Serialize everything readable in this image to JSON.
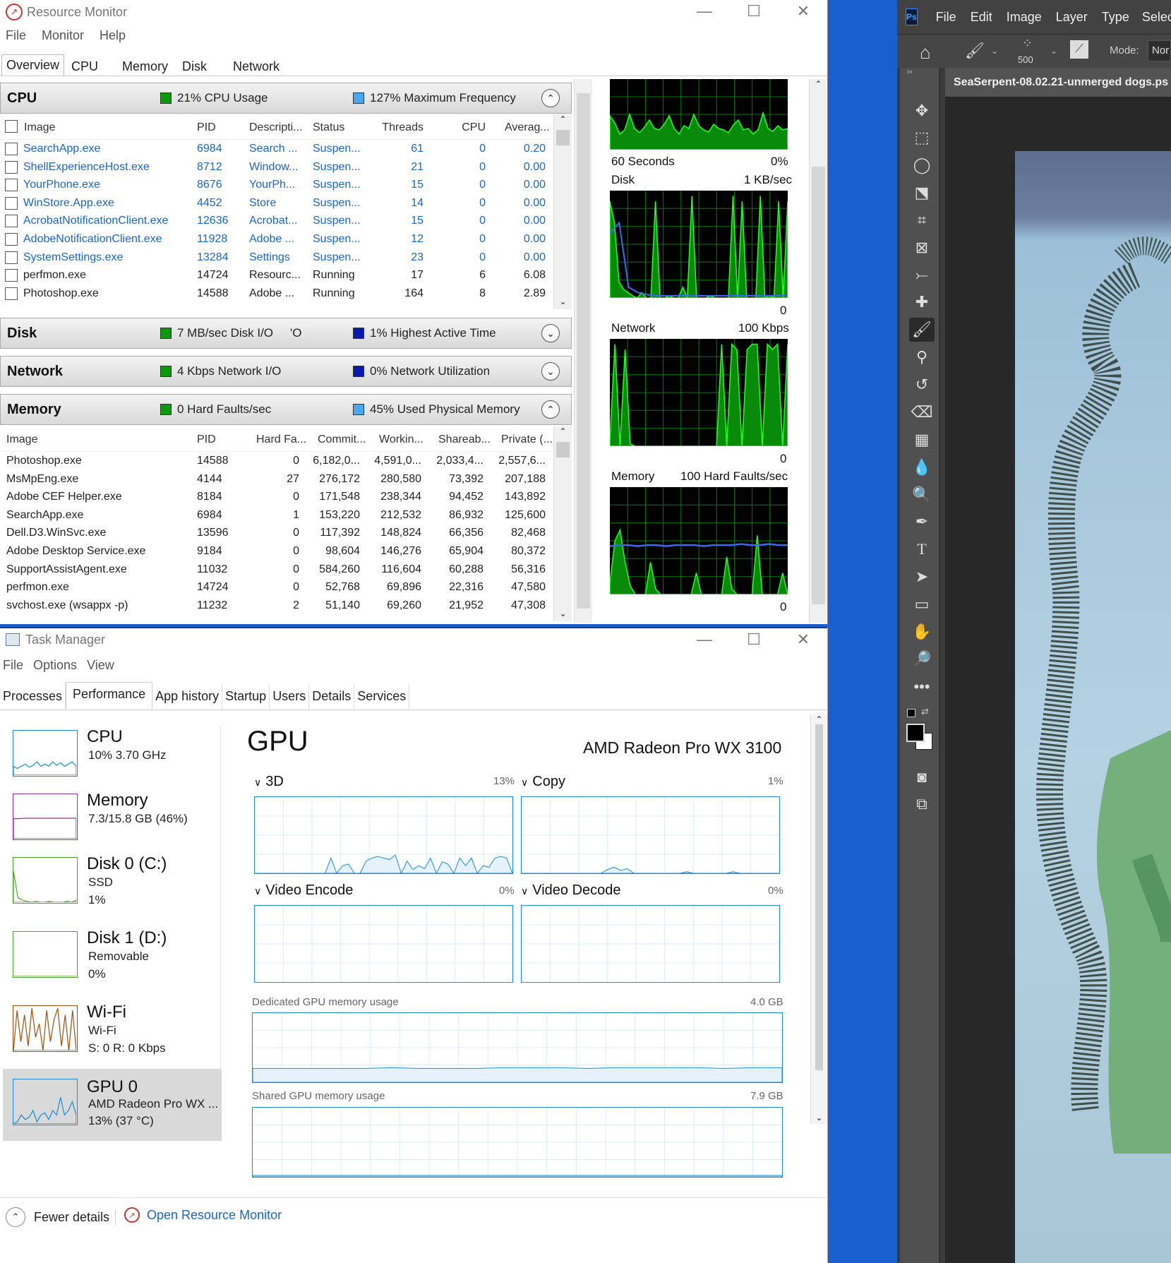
{
  "resource_monitor": {
    "title": "Resource Monitor",
    "menu": [
      "File",
      "Monitor",
      "Help"
    ],
    "tabs": [
      "Overview",
      "CPU",
      "Memory",
      "Disk",
      "Network"
    ],
    "cpu": {
      "name": "CPU",
      "stat1": "21% CPU Usage",
      "stat2": "127% Maximum Frequency",
      "columns": [
        "Image",
        "PID",
        "Descripti...",
        "Status",
        "Threads",
        "CPU",
        "Averag..."
      ],
      "rows": [
        {
          "image": "SearchApp.exe",
          "pid": "6984",
          "desc": "Search ...",
          "status": "Suspen...",
          "threads": "61",
          "cpu": "0",
          "avg": "0.20",
          "link": true
        },
        {
          "image": "ShellExperienceHost.exe",
          "pid": "8712",
          "desc": "Window...",
          "status": "Suspen...",
          "threads": "21",
          "cpu": "0",
          "avg": "0.00",
          "link": true
        },
        {
          "image": "YourPhone.exe",
          "pid": "8676",
          "desc": "YourPh...",
          "status": "Suspen...",
          "threads": "15",
          "cpu": "0",
          "avg": "0.00",
          "link": true
        },
        {
          "image": "WinStore.App.exe",
          "pid": "4452",
          "desc": "Store",
          "status": "Suspen...",
          "threads": "14",
          "cpu": "0",
          "avg": "0.00",
          "link": true
        },
        {
          "image": "AcrobatNotificationClient.exe",
          "pid": "12636",
          "desc": "Acrobat...",
          "status": "Suspen...",
          "threads": "15",
          "cpu": "0",
          "avg": "0.00",
          "link": true
        },
        {
          "image": "AdobeNotificationClient.exe",
          "pid": "11928",
          "desc": "Adobe ...",
          "status": "Suspen...",
          "threads": "12",
          "cpu": "0",
          "avg": "0.00",
          "link": true
        },
        {
          "image": "SystemSettings.exe",
          "pid": "13284",
          "desc": "Settings",
          "status": "Suspen...",
          "threads": "23",
          "cpu": "0",
          "avg": "0.00",
          "link": true
        },
        {
          "image": "perfmon.exe",
          "pid": "14724",
          "desc": "Resourc...",
          "status": "Running",
          "threads": "17",
          "cpu": "6",
          "avg": "6.08",
          "link": false
        },
        {
          "image": "Photoshop.exe",
          "pid": "14588",
          "desc": "Adobe ...",
          "status": "Running",
          "threads": "164",
          "cpu": "8",
          "avg": "2.89",
          "link": false
        }
      ]
    },
    "disk": {
      "name": "Disk",
      "stat1": "7 MB/sec Disk I/O",
      "stat1_extra": "'O",
      "stat2": "1% Highest Active Time"
    },
    "network": {
      "name": "Network",
      "stat1": "4 Kbps Network I/O",
      "stat2": "0% Network Utilization"
    },
    "memory": {
      "name": "Memory",
      "stat1": "0 Hard Faults/sec",
      "stat2": "45% Used Physical Memory",
      "columns": [
        "Image",
        "PID",
        "Hard Fa...",
        "Commit...",
        "Workin...",
        "Shareab...",
        "Private (..."
      ],
      "rows": [
        {
          "image": "Photoshop.exe",
          "pid": "14588",
          "hf": "0",
          "commit": "6,182,0...",
          "work": "4,591,0...",
          "share": "2,033,4...",
          "priv": "2,557,6..."
        },
        {
          "image": "MsMpEng.exe",
          "pid": "4144",
          "hf": "27",
          "commit": "276,172",
          "work": "280,580",
          "share": "73,392",
          "priv": "207,188"
        },
        {
          "image": "Adobe CEF Helper.exe",
          "pid": "8184",
          "hf": "0",
          "commit": "171,548",
          "work": "238,344",
          "share": "94,452",
          "priv": "143,892"
        },
        {
          "image": "SearchApp.exe",
          "pid": "6984",
          "hf": "1",
          "commit": "153,220",
          "work": "212,532",
          "share": "86,932",
          "priv": "125,600"
        },
        {
          "image": "Dell.D3.WinSvc.exe",
          "pid": "13596",
          "hf": "0",
          "commit": "117,392",
          "work": "148,824",
          "share": "66,356",
          "priv": "82,468"
        },
        {
          "image": "Adobe Desktop Service.exe",
          "pid": "9184",
          "hf": "0",
          "commit": "98,604",
          "work": "146,276",
          "share": "65,904",
          "priv": "80,372"
        },
        {
          "image": "SupportAssistAgent.exe",
          "pid": "11032",
          "hf": "0",
          "commit": "584,260",
          "work": "116,604",
          "share": "60,288",
          "priv": "56,316"
        },
        {
          "image": "perfmon.exe",
          "pid": "14724",
          "hf": "0",
          "commit": "52,768",
          "work": "69,896",
          "share": "22,316",
          "priv": "47,580"
        },
        {
          "image": "svchost.exe (wsappx -p)",
          "pid": "11232",
          "hf": "2",
          "commit": "51,140",
          "work": "69,260",
          "share": "21,952",
          "priv": "47,308"
        }
      ]
    },
    "graphs": {
      "cpu_footer_left": "60 Seconds",
      "cpu_footer_right": "0%",
      "disk_label": "Disk",
      "disk_scale": "1 KB/sec",
      "disk_zero": "0",
      "network_label": "Network",
      "network_scale": "100 Kbps",
      "network_zero": "0",
      "memory_label": "Memory",
      "memory_scale": "100 Hard Faults/sec",
      "memory_zero": "0"
    }
  },
  "task_manager": {
    "title": "Task Manager",
    "menu": [
      "File",
      "Options",
      "View"
    ],
    "tabs": [
      "Processes",
      "Performance",
      "App history",
      "Startup",
      "Users",
      "Details",
      "Services"
    ],
    "active_tab": "Performance",
    "sidebar": [
      {
        "title": "CPU",
        "sub1": "10%  3.70 GHz",
        "sub2": "",
        "sub3": "",
        "color": "#1a8cd8"
      },
      {
        "title": "Memory",
        "sub1": "7.3/15.8 GB (46%)",
        "sub2": "",
        "sub3": "",
        "color": "#9b2d9b"
      },
      {
        "title": "Disk 0 (C:)",
        "sub1": "SSD",
        "sub2": "1%",
        "sub3": "",
        "color": "#4aa82a"
      },
      {
        "title": "Disk 1 (D:)",
        "sub1": "Removable",
        "sub2": "0%",
        "sub3": "",
        "color": "#4aa82a"
      },
      {
        "title": "Wi-Fi",
        "sub1": "Wi-Fi",
        "sub2": "S: 0 R: 0 Kbps",
        "sub3": "",
        "color": "#a05010"
      },
      {
        "title": "GPU 0",
        "sub1": "AMD Radeon Pro WX ...",
        "sub2": "13%  (37 °C)",
        "sub3": "",
        "color": "#1a8cd8"
      }
    ],
    "gpu": {
      "title": "GPU",
      "model": "AMD Radeon Pro WX 3100",
      "engines": [
        {
          "label": "3D",
          "pct": "13%"
        },
        {
          "label": "Copy",
          "pct": "1%"
        },
        {
          "label": "Video Encode",
          "pct": "0%"
        },
        {
          "label": "Video Decode",
          "pct": "0%"
        }
      ],
      "dedicated_label": "Dedicated GPU memory usage",
      "dedicated_max": "4.0 GB",
      "shared_label": "Shared GPU memory usage",
      "shared_max": "7.9 GB"
    },
    "fewer_details": "Fewer details",
    "open_rm": "Open Resource Monitor"
  },
  "photoshop": {
    "logo": "Ps",
    "menu": [
      "File",
      "Edit",
      "Image",
      "Layer",
      "Type",
      "Select"
    ],
    "brush_size": "500",
    "mode_label": "Mode:",
    "mode_value": "Nor",
    "doc_title": "SeaSerpent-08.02.21-unmerged dogs.ps"
  }
}
